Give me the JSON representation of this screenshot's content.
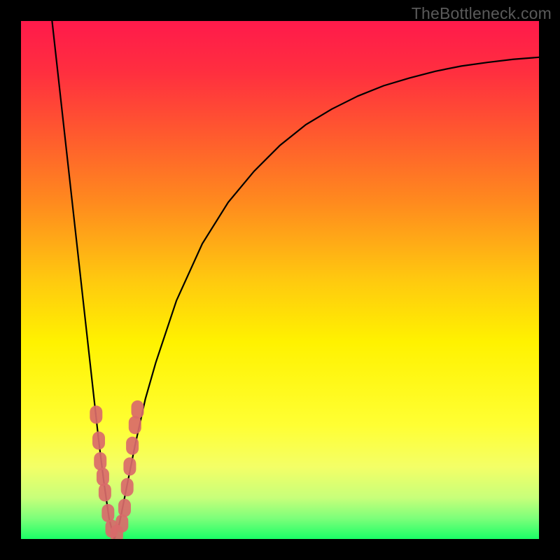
{
  "watermark": "TheBottleneck.com",
  "gradient": {
    "stops": [
      {
        "offset": 0.0,
        "color": "#ff1a4b"
      },
      {
        "offset": 0.1,
        "color": "#ff2f3f"
      },
      {
        "offset": 0.22,
        "color": "#ff5a2e"
      },
      {
        "offset": 0.35,
        "color": "#ff8a1e"
      },
      {
        "offset": 0.5,
        "color": "#ffc90f"
      },
      {
        "offset": 0.62,
        "color": "#fff200"
      },
      {
        "offset": 0.78,
        "color": "#ffff33"
      },
      {
        "offset": 0.86,
        "color": "#f4ff66"
      },
      {
        "offset": 0.92,
        "color": "#c8ff7a"
      },
      {
        "offset": 0.96,
        "color": "#7dff7a"
      },
      {
        "offset": 1.0,
        "color": "#1aff66"
      }
    ]
  },
  "chart_data": {
    "type": "line",
    "title": "",
    "xlabel": "",
    "ylabel": "",
    "xlim": [
      0,
      100
    ],
    "ylim": [
      0,
      100
    ],
    "x_optimum": 18,
    "series": [
      {
        "name": "bottleneck-curve",
        "x": [
          6,
          8,
          10,
          12,
          14,
          15,
          16,
          17,
          18,
          19,
          20,
          22,
          24,
          26,
          30,
          35,
          40,
          45,
          50,
          55,
          60,
          65,
          70,
          75,
          80,
          85,
          90,
          95,
          100
        ],
        "y": [
          100,
          82,
          64,
          46,
          28,
          19,
          11,
          4,
          0,
          3,
          8,
          18,
          27,
          34,
          46,
          57,
          65,
          71,
          76,
          80,
          83,
          85.5,
          87.5,
          89,
          90.3,
          91.3,
          92,
          92.6,
          93
        ]
      }
    ],
    "markers": {
      "name": "sample-points",
      "color": "#d96a6a",
      "points": [
        {
          "x": 14.5,
          "y": 24
        },
        {
          "x": 15.0,
          "y": 19
        },
        {
          "x": 15.3,
          "y": 15
        },
        {
          "x": 15.8,
          "y": 12
        },
        {
          "x": 16.2,
          "y": 9
        },
        {
          "x": 16.8,
          "y": 5
        },
        {
          "x": 17.5,
          "y": 2
        },
        {
          "x": 18.5,
          "y": 1
        },
        {
          "x": 19.5,
          "y": 3
        },
        {
          "x": 20.0,
          "y": 6
        },
        {
          "x": 20.5,
          "y": 10
        },
        {
          "x": 21.0,
          "y": 14
        },
        {
          "x": 21.5,
          "y": 18
        },
        {
          "x": 22.0,
          "y": 22
        },
        {
          "x": 22.5,
          "y": 25
        }
      ]
    }
  }
}
